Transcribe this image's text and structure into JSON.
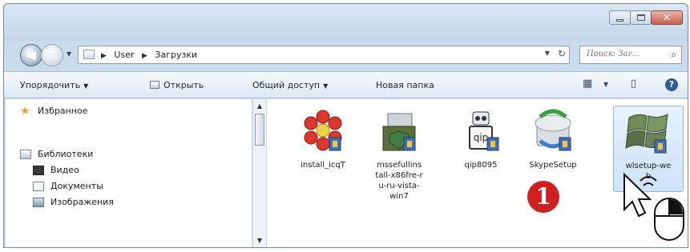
{
  "window": {
    "buttons": [
      "minimize",
      "maximize",
      "close"
    ]
  },
  "navigation": {
    "breadcrumb": [
      "User",
      "Загрузки"
    ],
    "search_placeholder": "Поиск: Заг... "
  },
  "toolbar": {
    "organize": "Упорядочить",
    "open": "Открыть",
    "share": "Общий доступ",
    "new_folder": "Новая папка"
  },
  "sidebar": {
    "favorites": "Избранное",
    "libraries": "Библиотеки",
    "items": [
      "Видео",
      "Документы",
      "Изображения"
    ]
  },
  "files": [
    {
      "name": "install_icqT",
      "icon": "icq-flower-icon"
    },
    {
      "name": "mssefullinstall-x86fre-ru-ru-vista-win7",
      "display": [
        "mssefullins",
        "tall-x86fre-r",
        "u-ru-vista-",
        "win7"
      ],
      "icon": "security-essentials-installer-icon"
    },
    {
      "name": "qip8095",
      "icon": "qip-robot-icon"
    },
    {
      "name": "SkypeSetup",
      "icon": "skype-setup-icon"
    },
    {
      "name": "wlsetup-web",
      "display": [
        "wlsetup-we",
        "b"
      ],
      "icon": "windows-live-setup-icon",
      "selected": true
    }
  ],
  "annotation": {
    "step_number": "1"
  },
  "colors": {
    "accent_red": "#cf1f1f",
    "selection": "#cfe3f9"
  }
}
